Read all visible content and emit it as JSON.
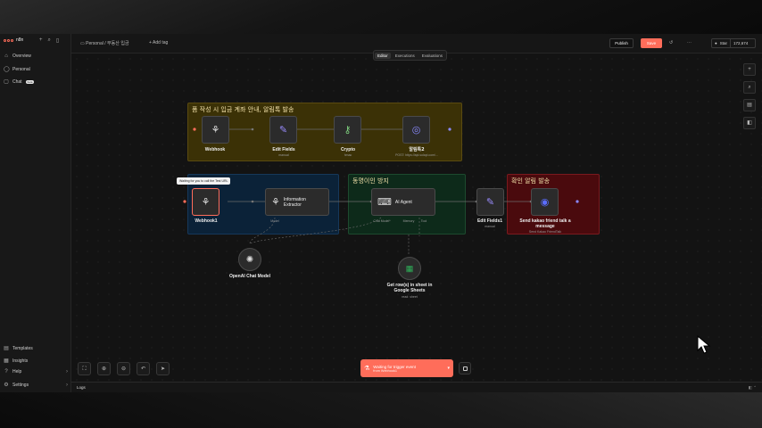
{
  "app": {
    "brand": "n8n",
    "colors": {
      "accent": "#ff6d5a",
      "sticky_yellow": "#3b3106",
      "sticky_blue": "#0b2238",
      "sticky_green": "#0d2a1a",
      "sticky_red": "#4a0a0d"
    }
  },
  "sidebar": {
    "top_icons": [
      "plus-icon",
      "search-icon",
      "panel-icon"
    ],
    "items": [
      {
        "label": "Overview",
        "icon": "home-icon"
      },
      {
        "label": "Personal",
        "icon": "user-icon"
      },
      {
        "label": "Chat",
        "icon": "chat-icon",
        "badge": "beta"
      }
    ],
    "bottom_items": [
      {
        "label": "Templates",
        "icon": "templates-icon"
      },
      {
        "label": "Insights",
        "icon": "insights-icon"
      },
      {
        "label": "Help",
        "icon": "help-icon"
      },
      {
        "label": "Settings",
        "icon": "gear-icon"
      }
    ]
  },
  "header": {
    "breadcrumb_parent": "Personal",
    "separator": "/",
    "workflow_name": "부동산 입금",
    "add_tag": "+ Add tag",
    "publish": "Publish",
    "save": "Save",
    "star": "Star",
    "star_count": "172,674"
  },
  "tabs": [
    {
      "label": "Editor",
      "active": true
    },
    {
      "label": "Executions",
      "active": false
    },
    {
      "label": "Evaluations",
      "active": false
    }
  ],
  "canvas": {
    "stickies": [
      {
        "title": "폼 작성 시 입금 계좌 안내, 알림톡 발송",
        "color": "yellow"
      },
      {
        "title": "",
        "color": "blue"
      },
      {
        "title": "동명이인 방지",
        "color": "green"
      },
      {
        "title": "확인 알림 발송",
        "color": "red"
      }
    ],
    "tooltip": "Waiting for you to call the Test URL",
    "nodes": {
      "webhook": {
        "label": "Webhook"
      },
      "edit_fields": {
        "label": "Edit Fields",
        "sub": "manual"
      },
      "crypto": {
        "label": "Crypto",
        "sub": "hmac"
      },
      "http": {
        "label": "알림톡2",
        "sub": "POST: https://api.solapi.com/..."
      },
      "webhook1": {
        "label": "Webhook1"
      },
      "info_extractor": {
        "label": "Information Extractor"
      },
      "ai_agent": {
        "label": "AI Agent"
      },
      "edit_fields1": {
        "label": "Edit Fields1",
        "sub": "manual"
      },
      "kakao": {
        "label": "Send kakao friend talk a message",
        "sub": "Send Kakao FriendTalk"
      },
      "openai": {
        "label": "OpenAI Chat Model"
      },
      "sheets": {
        "label": "Get row(s) in sheet in Google Sheets",
        "sub": "read: sheet"
      }
    },
    "port_labels": {
      "model": "Model",
      "chat_model": "Chat Model*",
      "memory": "Memory",
      "tool": "Tool"
    }
  },
  "bottom_toolbar": {
    "trigger_line1": "Waiting for trigger event",
    "trigger_line2": "from Webhook1"
  },
  "logs": {
    "label": "Logs"
  }
}
